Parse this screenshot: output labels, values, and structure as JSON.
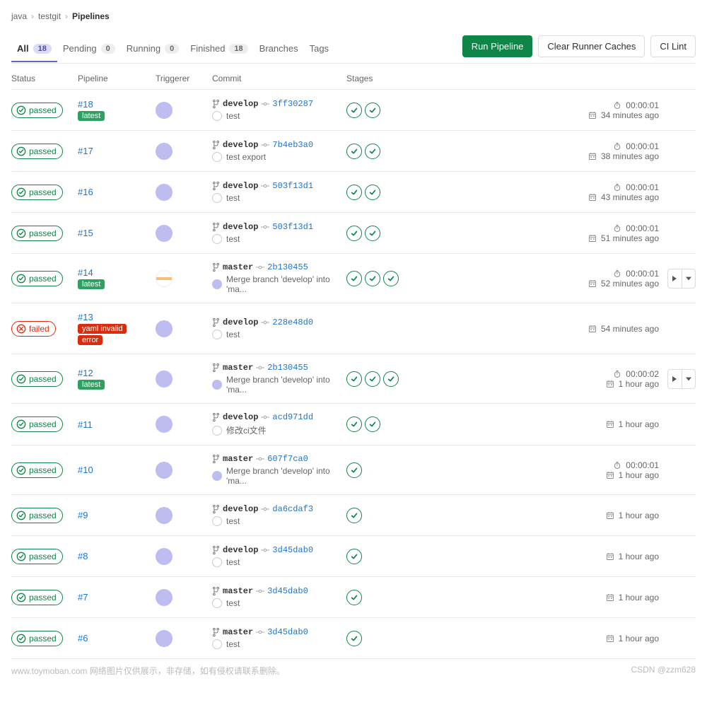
{
  "breadcrumb": {
    "group": "java",
    "project": "testgit",
    "current": "Pipelines"
  },
  "tabs": [
    {
      "label": "All",
      "count": "18",
      "active": true
    },
    {
      "label": "Pending",
      "count": "0"
    },
    {
      "label": "Running",
      "count": "0"
    },
    {
      "label": "Finished",
      "count": "18"
    },
    {
      "label": "Branches"
    },
    {
      "label": "Tags"
    }
  ],
  "actions": {
    "run": "Run Pipeline",
    "clear_cache": "Clear Runner Caches",
    "ci_lint": "CI Lint"
  },
  "columns": {
    "status": "Status",
    "pipeline": "Pipeline",
    "triggerer": "Triggerer",
    "commit": "Commit",
    "stages": "Stages"
  },
  "pipelines": [
    {
      "status": "passed",
      "id": "#18",
      "pills": [
        "latest"
      ],
      "branch": "develop",
      "sha": "3ff30287",
      "message": "test",
      "msg_fill": false,
      "stages": 2,
      "duration": "00:00:01",
      "time": "34 minutes ago"
    },
    {
      "status": "passed",
      "id": "#17",
      "pills": [],
      "branch": "develop",
      "sha": "7b4eb3a0",
      "message": "test export",
      "msg_fill": false,
      "stages": 2,
      "duration": "00:00:01",
      "time": "38 minutes ago"
    },
    {
      "status": "passed",
      "id": "#16",
      "pills": [],
      "branch": "develop",
      "sha": "503f13d1",
      "message": "test",
      "msg_fill": false,
      "stages": 2,
      "duration": "00:00:01",
      "time": "43 minutes ago"
    },
    {
      "status": "passed",
      "id": "#15",
      "pills": [],
      "branch": "develop",
      "sha": "503f13d1",
      "message": "test",
      "msg_fill": false,
      "stages": 2,
      "duration": "00:00:01",
      "time": "51 minutes ago"
    },
    {
      "status": "passed",
      "id": "#14",
      "pills": [
        "latest"
      ],
      "avatar_alt": true,
      "branch": "master",
      "sha": "2b130455",
      "message": "Merge branch 'develop' into 'ma...",
      "msg_fill": true,
      "stages": 3,
      "duration": "00:00:01",
      "time": "52 minutes ago",
      "row_actions": true
    },
    {
      "status": "failed",
      "id": "#13",
      "pills": [
        "yaml invalid",
        "error"
      ],
      "pill_red": true,
      "branch": "develop",
      "sha": "228e48d0",
      "message": "test",
      "msg_fill": false,
      "stages": 0,
      "time": "54 minutes ago"
    },
    {
      "status": "passed",
      "id": "#12",
      "pills": [
        "latest"
      ],
      "branch": "master",
      "sha": "2b130455",
      "message": "Merge branch 'develop' into 'ma...",
      "msg_fill": true,
      "stages": 3,
      "duration": "00:00:02",
      "time": "1 hour ago",
      "row_actions": true
    },
    {
      "status": "passed",
      "id": "#11",
      "pills": [],
      "branch": "develop",
      "sha": "acd971dd",
      "message": "修改ci文件",
      "msg_fill": false,
      "stages": 2,
      "time": "1 hour ago"
    },
    {
      "status": "passed",
      "id": "#10",
      "pills": [],
      "branch": "master",
      "sha": "607f7ca0",
      "message": "Merge branch 'develop' into 'ma...",
      "msg_fill": true,
      "stages": 1,
      "duration": "00:00:01",
      "time": "1 hour ago"
    },
    {
      "status": "passed",
      "id": "#9",
      "pills": [],
      "branch": "develop",
      "sha": "da6cdaf3",
      "message": "test",
      "msg_fill": false,
      "stages": 1,
      "time": "1 hour ago"
    },
    {
      "status": "passed",
      "id": "#8",
      "pills": [],
      "branch": "develop",
      "sha": "3d45dab0",
      "message": "test",
      "msg_fill": false,
      "stages": 1,
      "time": "1 hour ago"
    },
    {
      "status": "passed",
      "id": "#7",
      "pills": [],
      "branch": "master",
      "sha": "3d45dab0",
      "message": "test",
      "msg_fill": false,
      "stages": 1,
      "time": "1 hour ago"
    },
    {
      "status": "passed",
      "id": "#6",
      "pills": [],
      "branch": "master",
      "sha": "3d45dab0",
      "message": "test",
      "msg_fill": false,
      "stages": 1,
      "time": "1 hour ago"
    }
  ],
  "footer": {
    "left": "www.toymoban.com 网络图片仅供展示，非存储，如有侵权请联系删除。",
    "right": "CSDN @zzm628"
  }
}
